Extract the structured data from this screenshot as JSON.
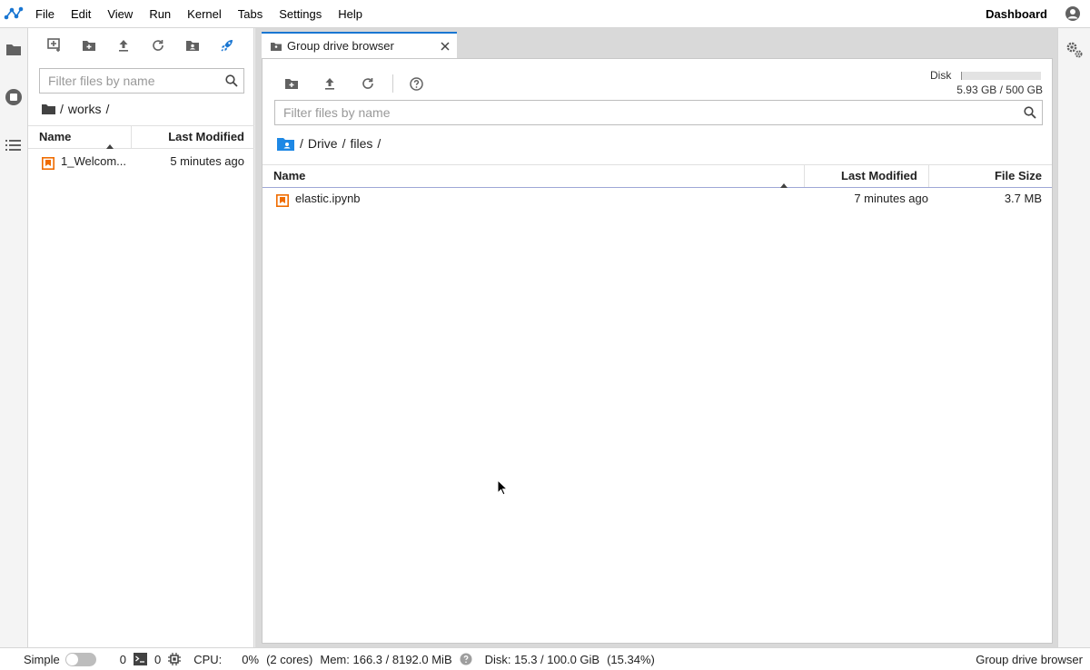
{
  "menubar": {
    "items": [
      "File",
      "Edit",
      "View",
      "Run",
      "Kernel",
      "Tabs",
      "Settings",
      "Help"
    ],
    "dashboard_label": "Dashboard"
  },
  "left_panel": {
    "filter_placeholder": "Filter files by name",
    "breadcrumb": [
      "/",
      "works",
      "/"
    ],
    "columns": {
      "name": "Name",
      "modified": "Last Modified"
    },
    "files": [
      {
        "name": "1_Welcom...",
        "modified": "5 minutes ago",
        "icon": "notebook-icon"
      }
    ]
  },
  "main": {
    "tab_title": "Group drive browser",
    "disk": {
      "label": "Disk",
      "value": "5.93 GB / 500 GB",
      "fraction": 0.012
    },
    "filter_placeholder": "Filter files by name",
    "breadcrumb": [
      "/",
      "Drive",
      "/",
      "files",
      "/"
    ],
    "columns": {
      "name": "Name",
      "modified": "Last Modified",
      "size": "File Size"
    },
    "files": [
      {
        "name": "elastic.ipynb",
        "modified": "7 minutes ago",
        "size": "3.7 MB",
        "icon": "notebook-icon"
      }
    ]
  },
  "statusbar": {
    "simple_label": "Simple",
    "terminals_count": "0",
    "kernels_count": "0",
    "cpu_label": "CPU:",
    "cpu_value": "0%",
    "cpu_cores": "(2 cores)",
    "mem": "Mem: 166.3 / 8192.0 MiB",
    "disk": "Disk: 15.3 / 100.0 GiB",
    "disk_percent": "(15.34%)",
    "right_label": "Group drive browser"
  },
  "colors": {
    "accent": "#1976d2",
    "notebook": "#ef6c00",
    "folder_blue": "#1e88e5"
  }
}
